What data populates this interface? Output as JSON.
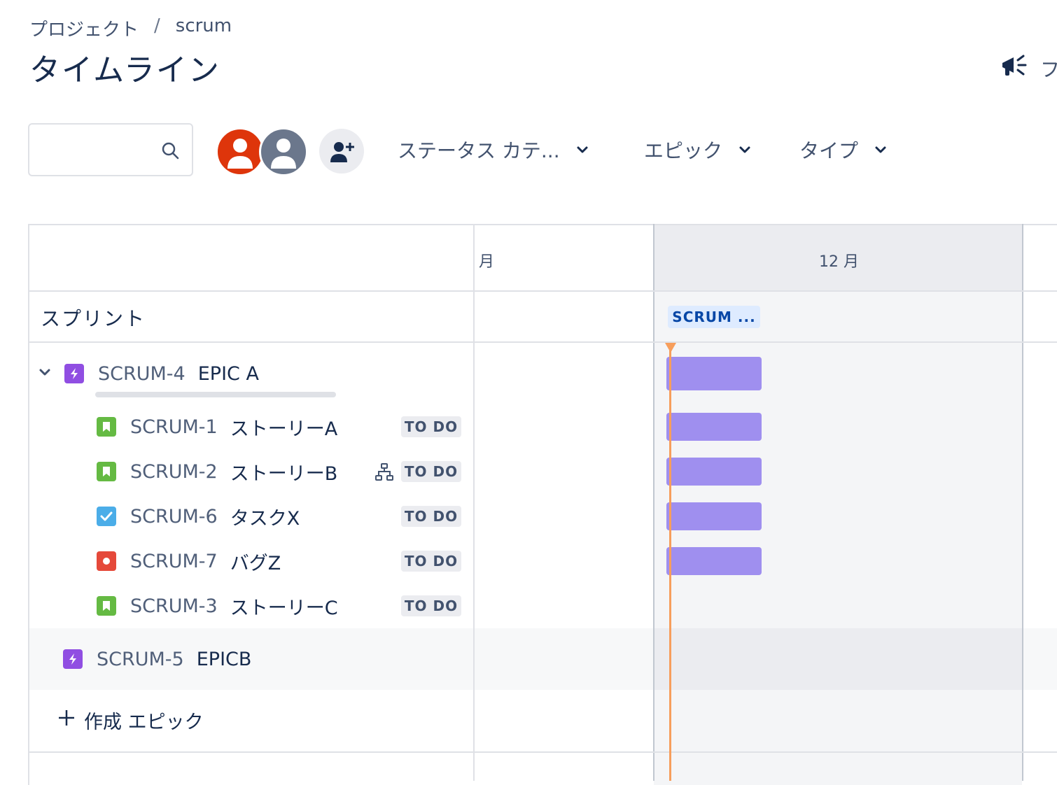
{
  "breadcrumb": {
    "project": "プロジェクト",
    "separator": "/",
    "current": "scrum"
  },
  "page": {
    "title": "タイムライン",
    "feedback_label": "フ"
  },
  "toolbar": {
    "search_value": "",
    "filters": [
      {
        "label": "ステータス カテ..."
      },
      {
        "label": "エピック"
      },
      {
        "label": "タイプ"
      }
    ]
  },
  "timeline": {
    "months": [
      {
        "label": "月"
      },
      {
        "label": "12 月"
      }
    ],
    "sprint_row_label": "スプリント",
    "sprint_chip": "SCRUM ...",
    "epics": [
      {
        "key": "SCRUM-4",
        "summary": "EPIC A",
        "issues": [
          {
            "key": "SCRUM-1",
            "summary": "ストーリーA",
            "status": "TO DO"
          },
          {
            "key": "SCRUM-2",
            "summary": "ストーリーB",
            "status": "TO DO"
          },
          {
            "key": "SCRUM-6",
            "summary": "タスクX",
            "status": "TO DO"
          },
          {
            "key": "SCRUM-7",
            "summary": "バグZ",
            "status": "TO DO"
          },
          {
            "key": "SCRUM-3",
            "summary": "ストーリーC",
            "status": "TO DO"
          }
        ]
      },
      {
        "key": "SCRUM-5",
        "summary": "EPICB"
      }
    ],
    "create_epic_label": "作成 エピック"
  },
  "colors": {
    "epic": "#904ee2",
    "story": "#65ba43",
    "task": "#4bade8",
    "bug": "#e5493a",
    "bar": "#9f8fef",
    "today": "#f79e5c",
    "sprint_chip_bg": "#deebff",
    "sprint_chip_text": "#0747a6"
  }
}
